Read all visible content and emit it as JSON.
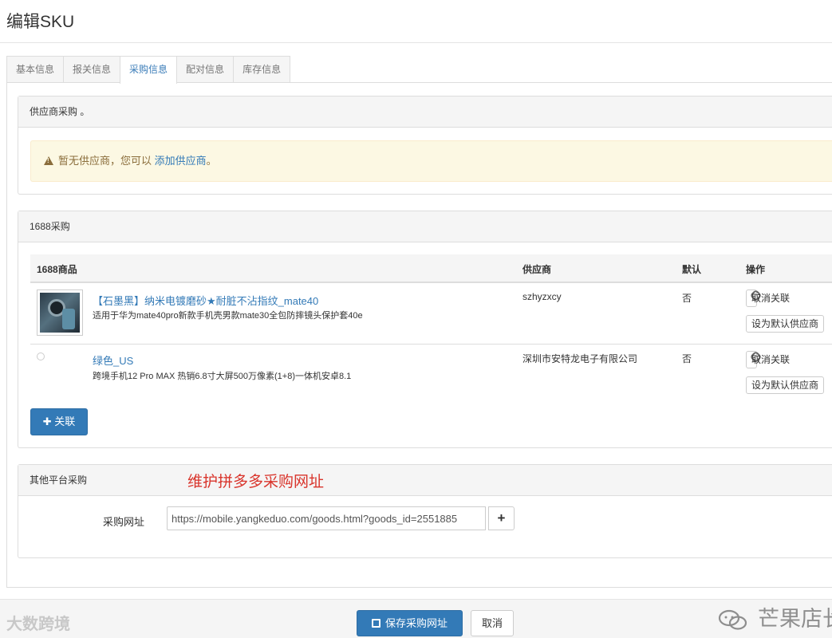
{
  "page": {
    "title": "编辑SKU"
  },
  "tabs": [
    {
      "label": "基本信息",
      "active": false
    },
    {
      "label": "报关信息",
      "active": false
    },
    {
      "label": "采购信息",
      "active": true
    },
    {
      "label": "配对信息",
      "active": false
    },
    {
      "label": "库存信息",
      "active": false
    }
  ],
  "supplier_panel": {
    "heading": "供应商采购 。",
    "alert_text": "暂无供应商，您可以",
    "alert_link": "添加供应商",
    "alert_end": "。"
  },
  "panel_1688": {
    "heading": "1688采购",
    "columns": {
      "product": "1688商品",
      "supplier": "供应商",
      "default": "默认",
      "actions": "操作"
    },
    "rows": [
      {
        "title": "【石墨黑】纳米电镀磨砂★耐脏不沾指纹_mate40",
        "desc": "适用于华为mate40pro新款手机壳男款mate30全包防摔镜头保护套40e",
        "supplier": "szhyzxcy",
        "default": "否",
        "unlink_label": "取消关联",
        "set_default_label": "设为默认供应商"
      },
      {
        "title": "绿色_US",
        "desc": "跨境手机12 Pro MAX 热销6.8寸大屏500万像素(1+8)一体机安卓8.1",
        "supplier": "深圳市安特龙电子有限公司",
        "default": "否",
        "unlink_label": "取消关联",
        "set_default_label": "设为默认供应商"
      }
    ],
    "link_button": "关联"
  },
  "other_panel": {
    "heading": "其他平台采购",
    "annotation": "维护拼多多采购网址",
    "url_label": "采购网址",
    "url_value": "https://mobile.yangkeduo.com/goods.html?goods_id=2551885"
  },
  "footer": {
    "save_label": "保存采购网址",
    "cancel_label": "取消",
    "watermark_left": "大数跨境",
    "watermark_right": "芒果店长"
  },
  "colors": {
    "primary": "#337ab7",
    "warning_bg": "#fcf8e3",
    "annotation_red": "#d9342b"
  }
}
